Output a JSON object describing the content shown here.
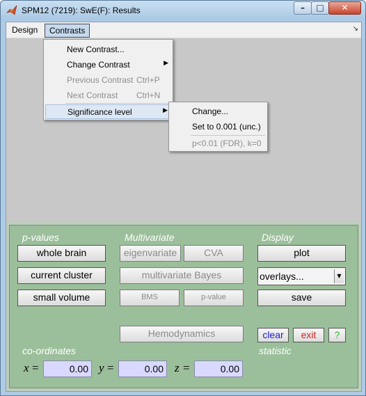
{
  "window": {
    "title": "SPM12 (7219): SwE(F): Results",
    "minimize_glyph": "–",
    "maximize_glyph": "□",
    "close_glyph": "✕"
  },
  "menubar": {
    "items": [
      {
        "label": "Design"
      },
      {
        "label": "Contrasts"
      }
    ],
    "overflow_glyph": "↘"
  },
  "contrasts_menu": {
    "items": [
      {
        "label": "New Contrast...",
        "enabled": true
      },
      {
        "label": "Change Contrast",
        "enabled": true,
        "submenu": true
      },
      {
        "label": "Previous Contrast",
        "enabled": false,
        "shortcut": "Ctrl+P"
      },
      {
        "label": "Next Contrast",
        "enabled": false,
        "shortcut": "Ctrl+N"
      },
      {
        "label": "Significance level",
        "enabled": true,
        "submenu": true,
        "highlighted": true
      }
    ],
    "arrow_glyph": "▶"
  },
  "significance_submenu": {
    "items": [
      {
        "label": "Change...",
        "enabled": true
      },
      {
        "label": "Set to 0.001 (unc.)",
        "enabled": true
      },
      {
        "label": "p<0.01 (FDR), k=0",
        "enabled": false
      }
    ]
  },
  "results_panel": {
    "headers": {
      "p_values": "p-values",
      "multivariate": "Multivariate",
      "display": "Display",
      "coordinates": "co-ordinates",
      "statistic": "statistic"
    },
    "pvalue_buttons": [
      "whole brain",
      "current cluster",
      "small volume"
    ],
    "multivariate_buttons": {
      "eigenvariate": "eigenvariate",
      "cva": "CVA",
      "multivariate_bayes": "multivariate Bayes",
      "bms": "BMS",
      "p_value": "p-value",
      "hemodynamics": "Hemodynamics"
    },
    "display": {
      "plot": "plot",
      "overlays_selected": "overlays...",
      "save": "save",
      "clear": "clear",
      "exit": "exit",
      "help": "?"
    },
    "coordinates": {
      "x_label": "x",
      "y_label": "y",
      "z_label": "z",
      "equals": "=",
      "x_value": "0.00",
      "y_value": "0.00",
      "z_value": "0.00"
    },
    "colors": {
      "panel_background": "#9bbf9b",
      "coordinate_field": "#d9d9ff",
      "clear_text": "#1c1cd6",
      "exit_text": "#d62020",
      "help_text": "#36b636"
    }
  }
}
